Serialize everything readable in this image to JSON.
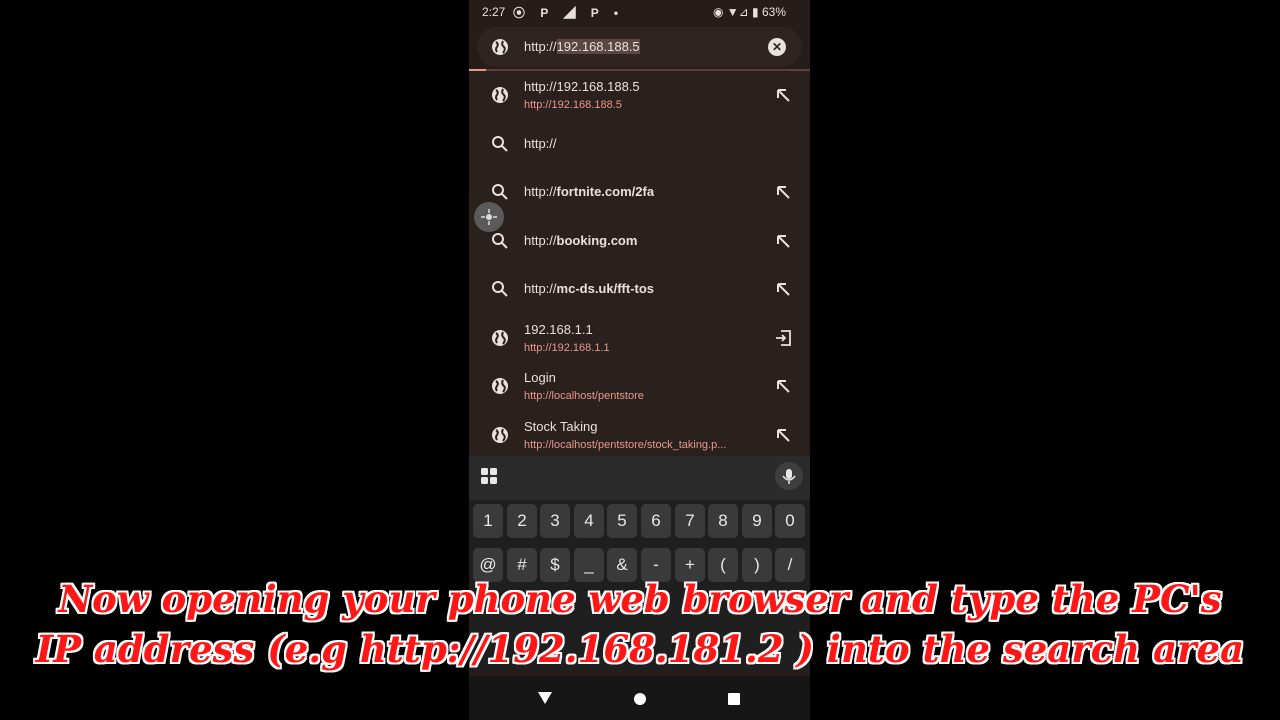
{
  "status_bar": {
    "time": "2:27",
    "left_icons": "⦿ P ◢ P •",
    "right_text": "◉ ▼⊿ ▮ 63%"
  },
  "url_bar": {
    "prefix": "http://",
    "highlight": "192.168.188.5"
  },
  "suggestions": [
    {
      "title_plain": "http://192.168.188.5",
      "title_bold": "",
      "subtitle": "http://192.168.188.5",
      "icon": "globe-icon",
      "action": "arrow-up-left-icon"
    },
    {
      "title_plain": "http://",
      "title_bold": "",
      "subtitle": "",
      "icon": "search-icon",
      "action": ""
    },
    {
      "title_plain": "http://",
      "title_bold": "fortnite.com/2fa",
      "subtitle": "",
      "icon": "search-icon",
      "action": "arrow-up-left-icon"
    },
    {
      "title_plain": "http://",
      "title_bold": "booking.com",
      "subtitle": "",
      "icon": "search-icon",
      "action": "arrow-up-left-icon"
    },
    {
      "title_plain": "http://",
      "title_bold": "mc-ds.uk/fft-tos",
      "subtitle": "",
      "icon": "search-icon",
      "action": "arrow-up-left-icon"
    },
    {
      "title_plain": "192.168.1.1",
      "title_bold": "",
      "subtitle": "http://192.168.1.1",
      "icon": "globe-icon",
      "action": "open-tab-icon"
    },
    {
      "title_plain": "Login",
      "title_bold": "",
      "subtitle": "http://localhost/pentstore",
      "icon": "globe-icon",
      "action": "arrow-up-left-icon"
    },
    {
      "title_plain": "Stock Taking",
      "title_bold": "",
      "subtitle": "http://localhost/pentstore/stock_taking.p...",
      "icon": "globe-icon",
      "action": "arrow-up-left-icon"
    }
  ],
  "keyboard": {
    "row1": [
      "1",
      "2",
      "3",
      "4",
      "5",
      "6",
      "7",
      "8",
      "9",
      "0"
    ],
    "row2": [
      "@",
      "#",
      "$",
      "_",
      "&",
      "-",
      "+",
      "(",
      ")",
      "/"
    ]
  },
  "caption": {
    "line1": "Now opening your phone web browser and type the PC's",
    "line2": "IP address (e.g http://192.168.181.2 ) into the search area"
  },
  "colors": {
    "accent": "#e9988a",
    "caption_text": "#ff1616",
    "surface": "#2a201e"
  }
}
